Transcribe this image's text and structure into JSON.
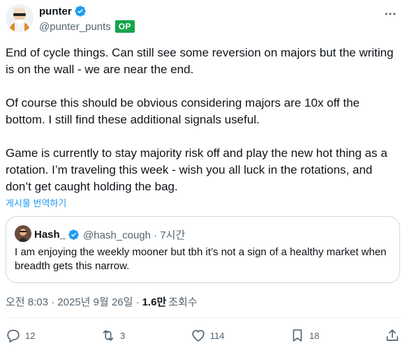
{
  "author": {
    "display_name": "punter",
    "handle": "@punter_punts",
    "badge": "OP",
    "verified_color": "#1d9bf0"
  },
  "post": {
    "paragraphs": [
      "End of cycle things. Can still see some reversion on majors but the writing is on the wall - we are near the end.",
      "Of course this should be obvious considering majors are 10x off the bottom. I still find these additional signals useful.",
      "Game is currently to stay majority risk off and play the new hot thing as a rotation. I’m traveling this week - wish you all luck in the rotations, and don’t get caught holding the bag."
    ],
    "translate_link": "게시물 번역하기"
  },
  "quote": {
    "display_name": "Hash_",
    "handle_time": "@hash_cough · 7시간",
    "text": "I am enjoying the weekly mooner but tbh it’s not a sign of a healthy market when breadth gets this narrow."
  },
  "meta": {
    "timestamp": "오전 8:03 · 2025년 9월 26일 ·",
    "views": "1.6만",
    "views_label": "조회수"
  },
  "actions": {
    "replies": "12",
    "reposts": "3",
    "likes": "114",
    "bookmarks": "18"
  },
  "icons": [
    "avatar",
    "verified-badge-icon",
    "more-icon",
    "reply-icon",
    "repost-icon",
    "like-icon",
    "bookmark-icon",
    "share-icon"
  ]
}
